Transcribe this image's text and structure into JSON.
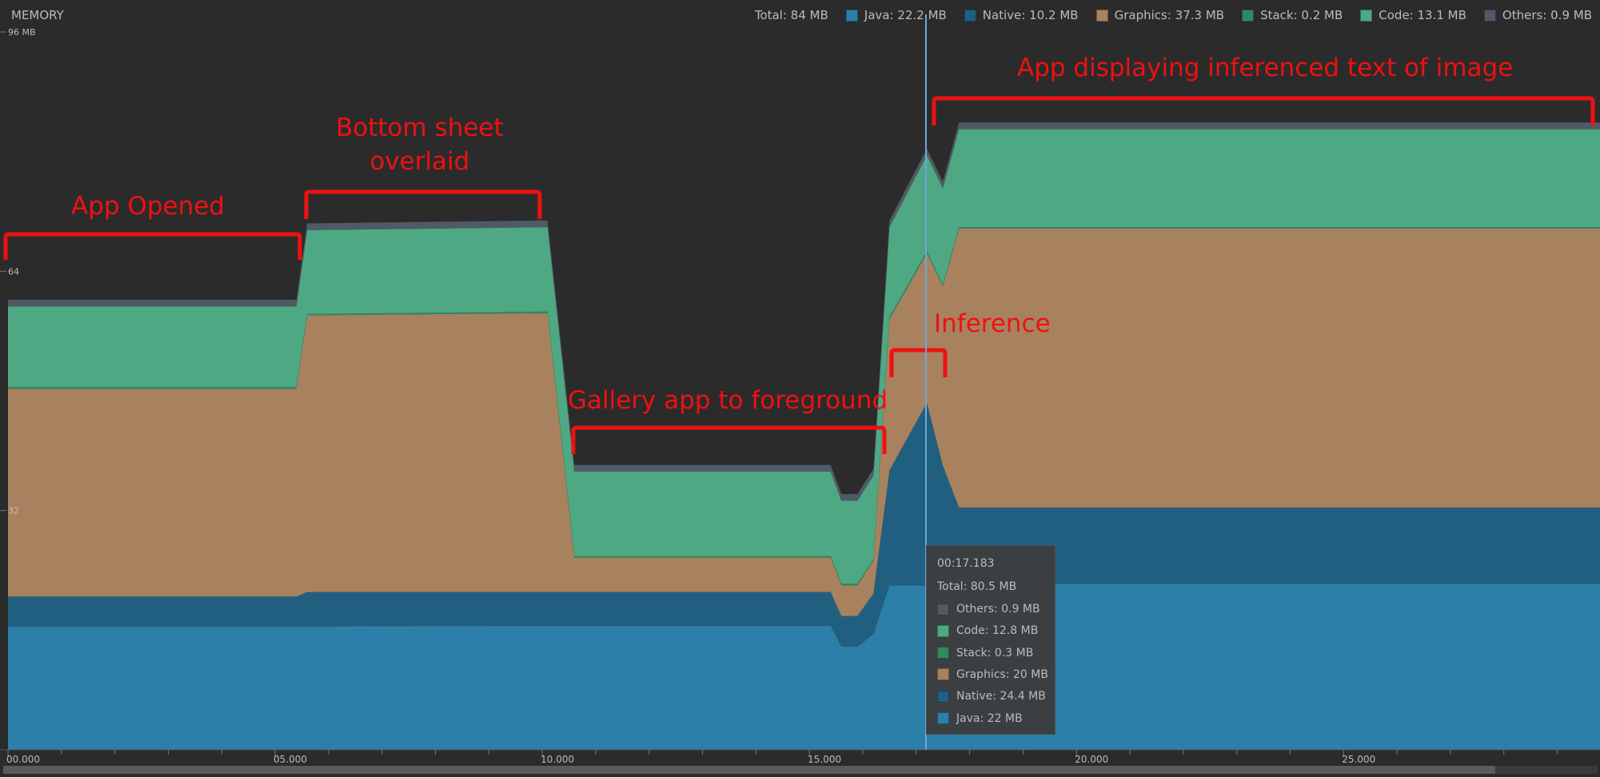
{
  "header": {
    "title": "MEMORY",
    "total": "Total: 84 MB",
    "legend": [
      {
        "label": "Java: 22.2 MB",
        "color": "#2c7fa8"
      },
      {
        "label": "Native: 10.2 MB",
        "color": "#215f80"
      },
      {
        "label": "Graphics: 37.3 MB",
        "color": "#a8825e"
      },
      {
        "label": "Stack: 0.2 MB",
        "color": "#2f8a5e"
      },
      {
        "label": "Code: 13.1 MB",
        "color": "#4ea883"
      },
      {
        "label": "Others: 0.9 MB",
        "color": "#4f5a66"
      }
    ]
  },
  "tooltip": {
    "time": "00:17.183",
    "total": "Total: 80.5 MB",
    "rows": [
      {
        "label": "Others: 0.9 MB",
        "color": "#4f5a66"
      },
      {
        "label": "Code: 12.8 MB",
        "color": "#4ea883"
      },
      {
        "label": "Stack: 0.3 MB",
        "color": "#2f8a5e"
      },
      {
        "label": "Graphics: 20 MB",
        "color": "#a8825e"
      },
      {
        "label": "Native: 24.4 MB",
        "color": "#215f80"
      },
      {
        "label": "Java: 22 MB",
        "color": "#2c7fa8"
      }
    ]
  },
  "annotations": [
    {
      "text": "App Opened"
    },
    {
      "text": "Bottom sheet\noverlaid"
    },
    {
      "text": "Gallery app to foreground"
    },
    {
      "text": "Inference"
    },
    {
      "text": "App displaying inferenced text of image"
    }
  ],
  "chart_data": {
    "type": "area",
    "stacked": true,
    "xlim": [
      0,
      29.8
    ],
    "ylim": [
      0,
      96
    ],
    "unit": "MB",
    "x_ticks": [
      "00.000",
      "05.000",
      "10.000",
      "15.000",
      "20.000",
      "25.000"
    ],
    "x_tick_values": [
      0,
      5,
      10,
      15,
      20,
      25
    ],
    "y_ticks": [
      "96 MB",
      "64",
      "32"
    ],
    "y_tick_values": [
      96,
      64,
      32
    ],
    "cursor_x": 17.183,
    "grid": false,
    "x": [
      0,
      5.4,
      5.6,
      10.1,
      10.6,
      15.4,
      15.6,
      15.9,
      16.2,
      16.5,
      17.2,
      17.5,
      17.8,
      29.8
    ],
    "series": [
      {
        "name": "Java",
        "color": "#2c7fa8",
        "values": [
          16.5,
          16.5,
          16.5,
          16.6,
          16.6,
          16.6,
          13.8,
          13.8,
          15.5,
          22,
          22,
          22,
          22.2,
          22.2
        ]
      },
      {
        "name": "Native",
        "color": "#215f80",
        "values": [
          4,
          4,
          4.6,
          4.5,
          4.5,
          4.5,
          4.1,
          4.1,
          5.4,
          15.4,
          24.4,
          16,
          10.2,
          10.2
        ]
      },
      {
        "name": "Graphics",
        "color": "#a8825e",
        "values": [
          27.8,
          27.8,
          37,
          37.3,
          4.6,
          4.6,
          4.1,
          4.1,
          4.4,
          20.2,
          20,
          24,
          37.3,
          37.3
        ]
      },
      {
        "name": "Stack",
        "color": "#2f8a5e",
        "values": [
          0.2,
          0.2,
          0.2,
          0.2,
          0.2,
          0.2,
          0.2,
          0.2,
          0.2,
          0.3,
          0.3,
          0.2,
          0.2,
          0.2
        ]
      },
      {
        "name": "Code",
        "color": "#4ea883",
        "values": [
          10.8,
          10.8,
          11.2,
          11.3,
          11.3,
          11.3,
          11.1,
          11.1,
          11.2,
          12,
          12.8,
          12.9,
          13.1,
          13.1
        ]
      },
      {
        "name": "Others",
        "color": "#4f5a66",
        "values": [
          0.9,
          0.9,
          0.9,
          0.9,
          0.9,
          0.9,
          0.9,
          0.9,
          0.9,
          0.9,
          0.9,
          0.9,
          0.9,
          0.9
        ]
      }
    ]
  }
}
